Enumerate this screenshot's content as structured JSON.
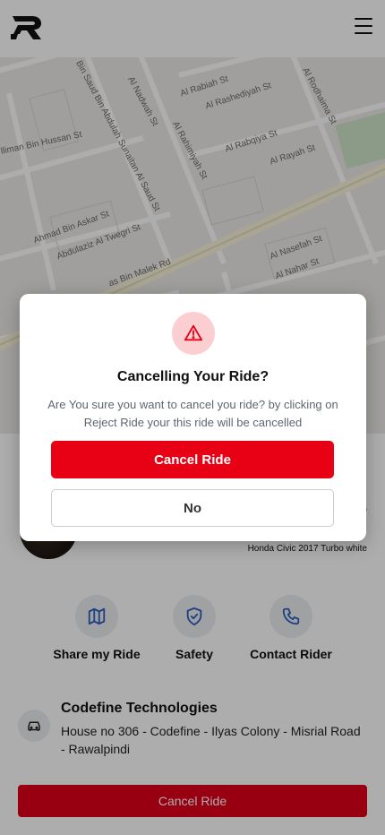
{
  "header": {
    "logo_icon": "brand-r-logo",
    "menu_icon": "hamburger-menu-icon"
  },
  "map": {
    "streets": [
      "Bin Saud Bin Abdulah Sunaitan Al Saud St",
      "Al Nadwah St",
      "Al Rabiah St",
      "Al Rashediyah St",
      "Al Rahimiyah St",
      "Al Rodhaima St",
      "lliman Bin Hussan St",
      "Al Rabqiya St",
      "Al Rayah St",
      "Ahmad Bin Askar St",
      "Abdulaziz Al Twegri St",
      "Al Nasefah St",
      "Al Nahar St",
      "as Bin Malek Rd"
    ]
  },
  "sheet": {
    "car_description": "Honda Civic 2017 Turbo white",
    "plate_fragment": "o",
    "actions": [
      {
        "label": "Share my Ride",
        "icon": "map-icon"
      },
      {
        "label": "Safety",
        "icon": "shield-check-icon"
      },
      {
        "label": "Contact Rider",
        "icon": "phone-icon"
      }
    ],
    "company": {
      "name": "Codefine Technologies",
      "address": "House no 306 - Codefine - Ilyas Colony - Misrial Road - Rawalpindi",
      "icon": "car-icon"
    },
    "cancel_label": "Cancel Ride"
  },
  "modal": {
    "icon": "warning-triangle-icon",
    "title": "Cancelling Your Ride?",
    "message": "Are You sure you want to cancel you ride? by clicking on Reject Ride your this ride will be cancelled",
    "confirm_label": "Cancel Ride",
    "dismiss_label": "No"
  },
  "colors": {
    "accent_red": "#e80014",
    "warning_bg": "#fbcfd1",
    "icon_blue": "#2b5fbf"
  }
}
